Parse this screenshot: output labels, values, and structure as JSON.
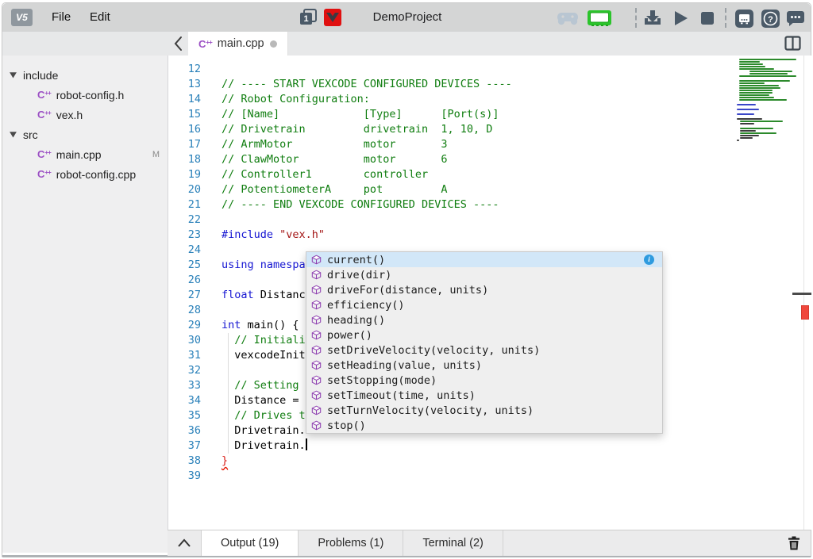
{
  "menubar": {
    "file": "File",
    "edit": "Edit"
  },
  "toolbar": {
    "slot_number": "1",
    "project_title": "DemoProject",
    "icons": [
      "program-slot-icon",
      "vex-logo-icon",
      "controller-icon",
      "brain-connected-icon",
      "download-icon",
      "play-icon",
      "stop-icon",
      "brain-settings-icon",
      "help-icon",
      "feedback-icon"
    ]
  },
  "tabbar": {
    "tab_label": "main.cpp",
    "modified": true
  },
  "sidebar": {
    "tree": [
      {
        "label": "include",
        "kind": "folder"
      },
      {
        "label": "robot-config.h",
        "kind": "file"
      },
      {
        "label": "vex.h",
        "kind": "file"
      },
      {
        "label": "src",
        "kind": "folder"
      },
      {
        "label": "main.cpp",
        "kind": "file",
        "badge": "M"
      },
      {
        "label": "robot-config.cpp",
        "kind": "file"
      }
    ]
  },
  "editor": {
    "lines": [
      {
        "n": 12,
        "tokens": []
      },
      {
        "n": 13,
        "tokens": [
          {
            "c": "c",
            "t": "// ---- START VEXCODE CONFIGURED DEVICES ----"
          }
        ]
      },
      {
        "n": 14,
        "tokens": [
          {
            "c": "c",
            "t": "// Robot Configuration:"
          }
        ]
      },
      {
        "n": 15,
        "tokens": [
          {
            "c": "c",
            "t": "// [Name]             [Type]      [Port(s)]"
          }
        ]
      },
      {
        "n": 16,
        "tokens": [
          {
            "c": "c",
            "t": "// Drivetrain         drivetrain  1, 10, D"
          }
        ]
      },
      {
        "n": 17,
        "tokens": [
          {
            "c": "c",
            "t": "// ArmMotor           motor       3"
          }
        ]
      },
      {
        "n": 18,
        "tokens": [
          {
            "c": "c",
            "t": "// ClawMotor          motor       6"
          }
        ]
      },
      {
        "n": 19,
        "tokens": [
          {
            "c": "c",
            "t": "// Controller1        controller"
          }
        ]
      },
      {
        "n": 20,
        "tokens": [
          {
            "c": "c",
            "t": "// PotentiometerA     pot         A"
          }
        ]
      },
      {
        "n": 21,
        "tokens": [
          {
            "c": "c",
            "t": "// ---- END VEXCODE CONFIGURED DEVICES ----"
          }
        ]
      },
      {
        "n": 22,
        "tokens": []
      },
      {
        "n": 23,
        "tokens": [
          {
            "c": "k",
            "t": "#include "
          },
          {
            "c": "s",
            "t": "\"vex.h\""
          }
        ]
      },
      {
        "n": 24,
        "tokens": []
      },
      {
        "n": 25,
        "tokens": [
          {
            "c": "k",
            "t": "using namespa"
          }
        ]
      },
      {
        "n": 26,
        "tokens": []
      },
      {
        "n": 27,
        "tokens": [
          {
            "c": "k",
            "t": "float"
          },
          {
            "c": "p",
            "t": " Distanc"
          }
        ]
      },
      {
        "n": 28,
        "tokens": []
      },
      {
        "n": 29,
        "tokens": [
          {
            "c": "k",
            "t": "int"
          },
          {
            "c": "p",
            "t": " main() {"
          }
        ]
      },
      {
        "n": 30,
        "tokens": [
          {
            "c": "p",
            "t": "  "
          },
          {
            "c": "c",
            "t": "// Initiali"
          }
        ]
      },
      {
        "n": 31,
        "tokens": [
          {
            "c": "p",
            "t": "  vexcodeInit"
          }
        ]
      },
      {
        "n": 32,
        "tokens": []
      },
      {
        "n": 33,
        "tokens": [
          {
            "c": "p",
            "t": "  "
          },
          {
            "c": "c",
            "t": "// Setting "
          }
        ]
      },
      {
        "n": 34,
        "tokens": [
          {
            "c": "p",
            "t": "  Distance = "
          }
        ]
      },
      {
        "n": 35,
        "tokens": [
          {
            "c": "p",
            "t": "  "
          },
          {
            "c": "c",
            "t": "// Drives t"
          }
        ]
      },
      {
        "n": 36,
        "tokens": [
          {
            "c": "p",
            "t": "  Drivetrain."
          }
        ]
      },
      {
        "n": 37,
        "tokens": [
          {
            "c": "p",
            "t": "  Drivetrain."
          }
        ],
        "cursor": true
      },
      {
        "n": 38,
        "tokens": [
          {
            "c": "e",
            "t": "}"
          }
        ]
      },
      {
        "n": 39,
        "tokens": []
      }
    ],
    "autocomplete": {
      "items": [
        {
          "label": "current()",
          "selected": true
        },
        {
          "label": "drive(dir)"
        },
        {
          "label": "driveFor(distance, units)"
        },
        {
          "label": "efficiency()"
        },
        {
          "label": "heading()"
        },
        {
          "label": "power()"
        },
        {
          "label": "setDriveVelocity(velocity, units)"
        },
        {
          "label": "setHeading(value, units)"
        },
        {
          "label": "setStopping(mode)"
        },
        {
          "label": "setTimeout(time, units)"
        },
        {
          "label": "setTurnVelocity(velocity, units)"
        },
        {
          "label": "stop()"
        }
      ]
    },
    "minimap": {
      "rows": [
        [
          3,
          72,
          "g"
        ],
        [
          3,
          26,
          "g"
        ],
        [
          3,
          30,
          "g"
        ],
        [
          3,
          33,
          "g"
        ],
        [
          3,
          44,
          "g"
        ],
        [
          16,
          54,
          "g"
        ],
        [
          16,
          48,
          "g"
        ],
        [
          3,
          72,
          "g"
        ],
        [
          0,
          0,
          "x"
        ],
        [
          3,
          64,
          "g"
        ],
        [
          3,
          32,
          "g"
        ],
        [
          3,
          50,
          "g"
        ],
        [
          3,
          52,
          "g"
        ],
        [
          3,
          42,
          "g"
        ],
        [
          3,
          42,
          "g"
        ],
        [
          3,
          38,
          "g"
        ],
        [
          3,
          44,
          "g"
        ],
        [
          3,
          60,
          "g"
        ],
        [
          0,
          0,
          "x"
        ],
        [
          0,
          24,
          "b"
        ],
        [
          0,
          0,
          "x"
        ],
        [
          0,
          28,
          "b"
        ],
        [
          0,
          0,
          "x"
        ],
        [
          0,
          22,
          "b"
        ],
        [
          0,
          0,
          "x"
        ],
        [
          0,
          32,
          "k"
        ],
        [
          4,
          54,
          "g"
        ],
        [
          4,
          18,
          "k"
        ],
        [
          0,
          0,
          "x"
        ],
        [
          4,
          42,
          "g"
        ],
        [
          4,
          20,
          "k"
        ],
        [
          4,
          46,
          "g"
        ],
        [
          4,
          24,
          "k"
        ],
        [
          4,
          16,
          "k"
        ],
        [
          0,
          3,
          "k"
        ]
      ]
    }
  },
  "bottombar": {
    "tabs": [
      {
        "label": "Output (19)",
        "active": true
      },
      {
        "label": "Problems (1)",
        "active": false
      },
      {
        "label": "Terminal (2)",
        "active": false
      }
    ]
  },
  "colors": {
    "accent_green": "#2bc42b",
    "vex_red": "#e01010",
    "selection_blue": "#d2e7f8",
    "error_red": "#e51400",
    "comment_green": "#0f7d0f",
    "keyword_blue": "#1414d2",
    "string_red": "#a31515"
  }
}
